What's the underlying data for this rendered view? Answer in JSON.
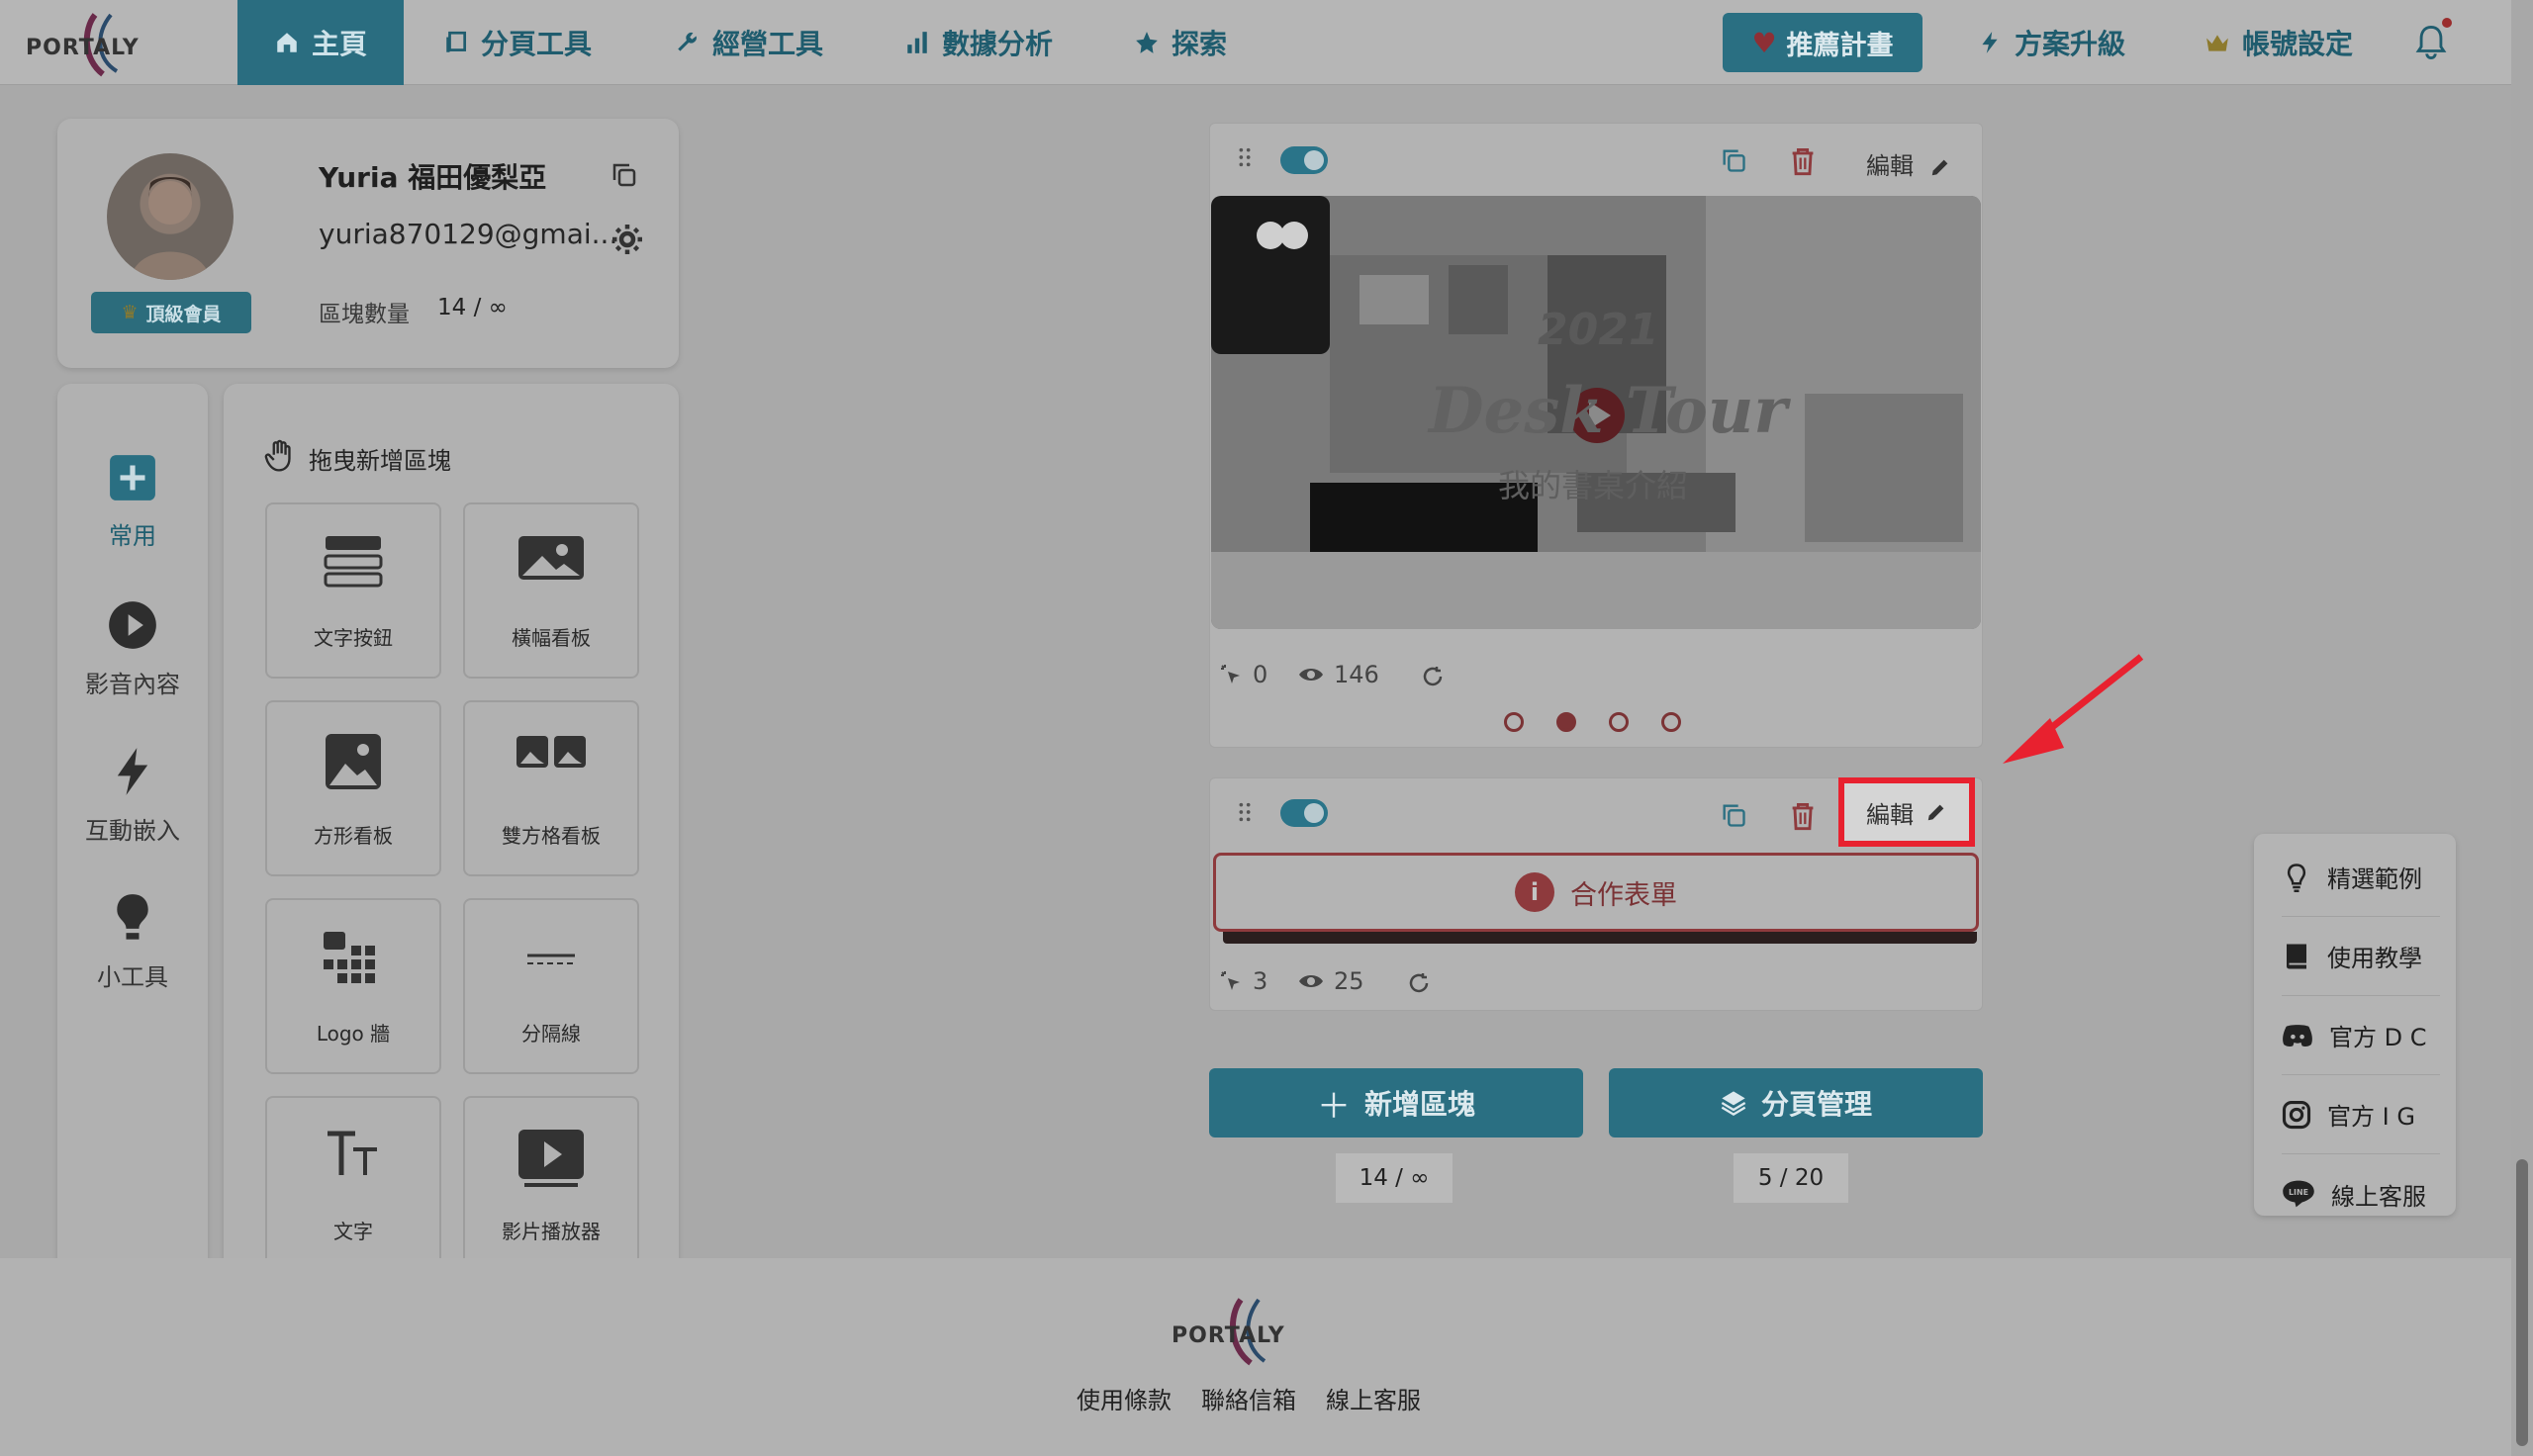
{
  "brand": {
    "logo_text": "PORTALY"
  },
  "nav": {
    "items": [
      {
        "label": "主頁",
        "icon": "home-icon",
        "active": true
      },
      {
        "label": "分頁工具",
        "icon": "pages-icon"
      },
      {
        "label": "經營工具",
        "icon": "wrench-icon"
      },
      {
        "label": "數據分析",
        "icon": "bar-chart-icon"
      },
      {
        "label": "探索",
        "icon": "star-icon"
      }
    ],
    "referral_label": "推薦計畫",
    "upgrade_label": "方案升級",
    "account_label": "帳號設定"
  },
  "profile": {
    "name": "Yuria 福田優梨亞",
    "email": "yuria870129@gmai...",
    "badge": "頂級會員",
    "block_count_label": "區塊數量",
    "block_count_value": "14 / ∞"
  },
  "sidebar": {
    "categories": [
      {
        "label": "常用",
        "icon": "plus-square-icon",
        "active": true
      },
      {
        "label": "影音內容",
        "icon": "play-circle-icon"
      },
      {
        "label": "互動嵌入",
        "icon": "lightning-icon"
      },
      {
        "label": "小工具",
        "icon": "lightbulb-icon"
      }
    ]
  },
  "blocks_panel": {
    "title": "拖曳新增區塊",
    "tiles": [
      "文字按鈕",
      "橫幅看板",
      "方形看板",
      "雙方格看板",
      "Logo 牆",
      "分隔線",
      "文字",
      "影片播放器"
    ]
  },
  "editor": {
    "card1": {
      "edit_label": "編輯",
      "video_overlay_year": "2021",
      "video_overlay_title": "Desk Tour",
      "video_overlay_subtitle": "我的書桌介紹",
      "clicks": "0",
      "views": "146"
    },
    "card2": {
      "edit_label": "編輯",
      "button_label": "合作表單",
      "clicks": "3",
      "views": "25"
    },
    "add_block_label": "新增區塊",
    "page_manage_label": "分頁管理",
    "block_count": "14 / ∞",
    "page_count": "5 / 20"
  },
  "float_menu": {
    "items": [
      {
        "label": "精選範例",
        "icon": "lightbulb-icon"
      },
      {
        "label": "使用教學",
        "icon": "book-icon"
      },
      {
        "label": "官方 D C",
        "icon": "discord-icon"
      },
      {
        "label": "官方 I G",
        "icon": "instagram-icon"
      },
      {
        "label": "線上客服",
        "icon": "line-icon"
      }
    ]
  },
  "footer": {
    "logo_text": "PORTALY",
    "links": [
      "使用條款",
      "聯絡信箱",
      "線上客服"
    ]
  },
  "colors": {
    "primary": "#2a6f82",
    "danger": "#8e3a3d",
    "highlight": "#e8212f",
    "overlay_bg": "#a9a9a9"
  }
}
